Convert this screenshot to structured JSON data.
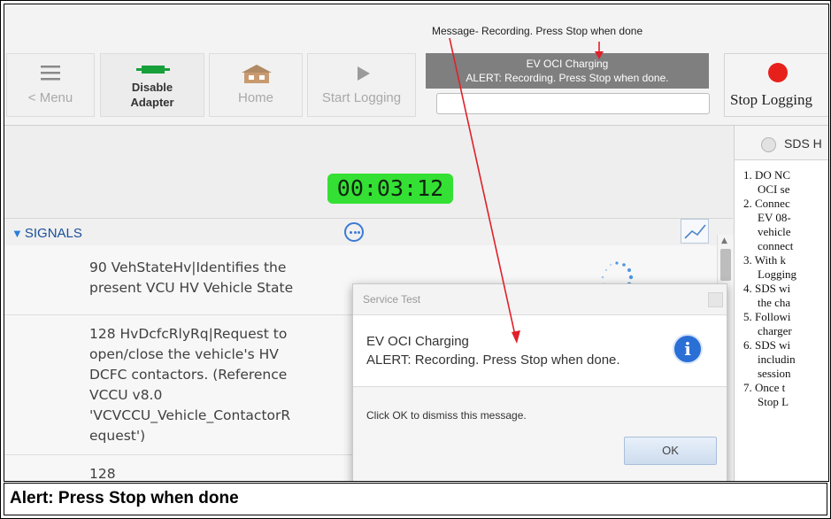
{
  "toolbar": {
    "menu_label": "< Menu",
    "disable_adapter_label": "Disable Adapter",
    "home_label": "Home",
    "start_logging_label": "Start Logging",
    "stop_logging_label": "Stop Logging",
    "top_message": "Message- Recording. Press Stop when done",
    "status_line1": "EV OCI Charging",
    "status_line2": "ALERT: Recording.  Press Stop when done.",
    "status_input_value": ""
  },
  "timer": "00:03:12",
  "signals": {
    "title": "SIGNALS",
    "rows": [
      {
        "line1": "90 VehStateHv|Identifies the",
        "line2": "present VCU HV Vehicle State"
      },
      {
        "lines": [
          "128 HvDcfcRlyRq|Request to",
          "open/close the vehicle's HV",
          "DCFC contactors. (Reference",
          "VCCU v8.0",
          "'VCVCCU_Vehicle_ContactorR",
          "equest')"
        ]
      },
      {
        "line1": "128"
      }
    ]
  },
  "sds_panel": {
    "tab_label": "SDS H",
    "items": [
      {
        "num": "1.",
        "l1": "DO NC",
        "l2": "OCI se"
      },
      {
        "num": "2.",
        "l1": "Connec",
        "l2": "EV 08-",
        "l3": "vehicle",
        "l4": "connect"
      },
      {
        "num": "3.",
        "l1": "With k",
        "l2": "Logging"
      },
      {
        "num": "4.",
        "l1": "SDS wi",
        "l2": "the cha"
      },
      {
        "num": "5.",
        "l1": "Followi",
        "l2": "charger"
      },
      {
        "num": "6.",
        "l1": "SDS wi",
        "l2": "includin",
        "l3": "session"
      },
      {
        "num": "7.",
        "l1": "Once t",
        "l2": "Stop L"
      }
    ]
  },
  "dialog": {
    "title": "Service Test",
    "message_line1": "EV OCI Charging",
    "message_line2": "ALERT: Recording.  Press Stop when done.",
    "footer_text": "Click OK to dismiss this message.",
    "ok_label": "OK"
  },
  "caption": "Alert: Press Stop when done",
  "colors": {
    "timer_bg": "#33e033",
    "status_bg": "#7f7f7f",
    "annotation_arrow": "#e0202a",
    "info_icon": "#2a6fd6",
    "stop_icon": "#e8201c"
  }
}
